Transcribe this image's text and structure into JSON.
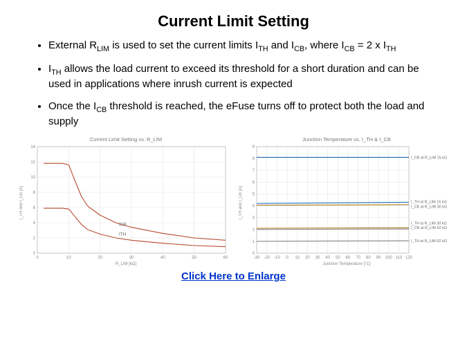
{
  "title": "Current Limit Setting",
  "bullets": [
    {
      "pre": "External R",
      "sub1": "LIM",
      "mid1": " is used to set the current limits I",
      "sub2": "TH",
      "mid2": " and I",
      "sub3": "CB",
      "mid3": ", where I",
      "sub4": "CB",
      "mid4": " = 2 x I",
      "sub5": "TH",
      "post": ""
    },
    {
      "pre": "I",
      "sub1": "TH",
      "mid1": " allows the load current to exceed its threshold for a short duration and can be used in applications where inrush current is expected",
      "sub2": "",
      "mid2": "",
      "sub3": "",
      "mid3": "",
      "sub4": "",
      "mid4": "",
      "sub5": "",
      "post": ""
    },
    {
      "pre": "Once the I",
      "sub1": "CB",
      "mid1": " threshold is reached, the eFuse turns off to protect both the load and supply",
      "sub2": "",
      "mid2": "",
      "sub3": "",
      "mid3": "",
      "sub4": "",
      "mid4": "",
      "sub5": "",
      "post": ""
    }
  ],
  "enlarge_label": "Click Here to Enlarge",
  "chart_data": [
    {
      "type": "line",
      "title": "Current Limit Setting vs. R_LIM",
      "xlabel": "R_LIM [kΩ]",
      "ylabel": "I_TH and I_CB [A]",
      "xlim": [
        0,
        60
      ],
      "ylim": [
        0,
        14
      ],
      "x_ticks": [
        0,
        10,
        20,
        30,
        40,
        50,
        60
      ],
      "y_ticks": [
        0,
        2,
        4,
        6,
        8,
        10,
        12,
        14
      ],
      "series": [
        {
          "name": "ICB",
          "color": "#b94a2f",
          "x": [
            2,
            8,
            10,
            12,
            14,
            16,
            20,
            25,
            30,
            40,
            50,
            60
          ],
          "y": [
            11.8,
            11.8,
            11.6,
            9.5,
            7.5,
            6.2,
            5.0,
            4.0,
            3.4,
            2.6,
            2.0,
            1.7
          ]
        },
        {
          "name": "ITH",
          "color": "#b94a2f",
          "x": [
            2,
            8,
            10,
            12,
            14,
            16,
            20,
            25,
            30,
            40,
            50,
            60
          ],
          "y": [
            5.9,
            5.9,
            5.8,
            4.8,
            3.8,
            3.1,
            2.5,
            2.0,
            1.7,
            1.3,
            1.0,
            0.85
          ]
        }
      ],
      "labels": [
        {
          "text": "ICB",
          "x": 26,
          "y": 3.6
        },
        {
          "text": "ITH",
          "x": 26,
          "y": 2.3
        }
      ]
    },
    {
      "type": "line",
      "title": "Junction Temperature vs. I_TH & I_CB",
      "xlabel": "Junction Temperature [°C]",
      "ylabel": "I_TH and I_CB [A]",
      "xlim": [
        -30,
        120
      ],
      "ylim": [
        0,
        9
      ],
      "x_ticks": [
        -30,
        -20,
        -10,
        0,
        10,
        20,
        30,
        40,
        50,
        60,
        70,
        80,
        90,
        100,
        110,
        120
      ],
      "y_ticks": [
        0,
        1,
        2,
        3,
        4,
        5,
        6,
        7,
        8,
        9
      ],
      "series": [
        {
          "name": "I_CB at R_LIM 15 kΩ",
          "color": "#1f6fb3",
          "x": [
            -30,
            120
          ],
          "y": [
            8.1,
            8.1
          ]
        },
        {
          "name": "I_TH at R_LIM 15 kΩ",
          "color": "#1f6fb3",
          "x": [
            -30,
            120
          ],
          "y": [
            4.2,
            4.3
          ]
        },
        {
          "name": "I_CB at R_LIM 30 kΩ",
          "color": "#b37a1f",
          "x": [
            -30,
            120
          ],
          "y": [
            4.05,
            4.1
          ]
        },
        {
          "name": "I_TH at R_LIM 30 kΩ",
          "color": "#b37a1f",
          "x": [
            -30,
            120
          ],
          "y": [
            2.1,
            2.15
          ]
        },
        {
          "name": "I_CB at R_LIM 62 kΩ",
          "color": "#888888",
          "x": [
            -30,
            120
          ],
          "y": [
            2.0,
            2.05
          ]
        },
        {
          "name": "I_TH at R_LIM 62 kΩ",
          "color": "#888888",
          "x": [
            -30,
            120
          ],
          "y": [
            1.0,
            1.05
          ]
        }
      ],
      "legend": [
        {
          "text": "I_CB at R_LIM 15 kΩ",
          "y": 8.1
        },
        {
          "text": "I_TH at R_LIM 15 kΩ",
          "y": 4.35
        },
        {
          "text": "I_CB at R_LIM 30 kΩ",
          "y": 3.95
        },
        {
          "text": "I_TH at R_LIM 30 kΩ",
          "y": 2.55
        },
        {
          "text": "I_CB at R_LIM 62 kΩ",
          "y": 2.15
        },
        {
          "text": "I_TH at R_LIM 62 kΩ",
          "y": 1.05
        }
      ]
    }
  ]
}
